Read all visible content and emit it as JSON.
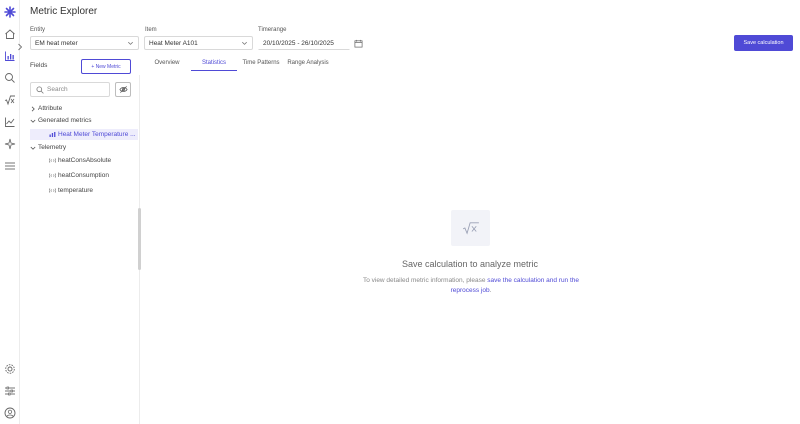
{
  "app": {
    "title": "Metric Explorer",
    "logo_icon": "cross-star-logo-icon"
  },
  "rail": {
    "top_icons": [
      "home-icon",
      "bar-chart-icon",
      "search-chart-icon",
      "sqrt-icon",
      "trend-line-icon",
      "sparkle-icon",
      "list-icon"
    ],
    "bottom_icons": [
      "settings-icon",
      "sliders-icon",
      "user-circle-icon"
    ]
  },
  "filters": {
    "entity": {
      "label": "Entity",
      "value": "EM heat meter"
    },
    "item": {
      "label": "Item",
      "value": "Heat Meter A101"
    },
    "timerange": {
      "label": "Timerange",
      "value": "20/10/2025 - 26/10/2025"
    }
  },
  "toolbar": {
    "save_label": "Save calculation"
  },
  "tabs": [
    {
      "label": "Overview",
      "active": false
    },
    {
      "label": "Statistics",
      "active": true
    },
    {
      "label": "Time Patterns",
      "active": false
    },
    {
      "label": "Range Analysis",
      "active": false
    }
  ],
  "fields": {
    "label": "Fields",
    "new_metric_label": "+ New Metric",
    "search_placeholder": "Search",
    "groups": {
      "attribute": "Attribute",
      "generated": "Generated metrics",
      "generated_item": "Heat Meter Temperature ...",
      "telemetry": "Telemetry",
      "telemetry_items": [
        "heatConsAbsolute",
        "heatConsumption",
        "temperature"
      ]
    }
  },
  "empty_state": {
    "title": "Save calculation to analyze metric",
    "desc_prefix": "To view detailed metric information, please ",
    "desc_link": "save the calculation and run the reprocess job",
    "desc_suffix": "."
  },
  "colors": {
    "accent": "#4f4ad6",
    "selected_bg": "#eeedfc"
  }
}
